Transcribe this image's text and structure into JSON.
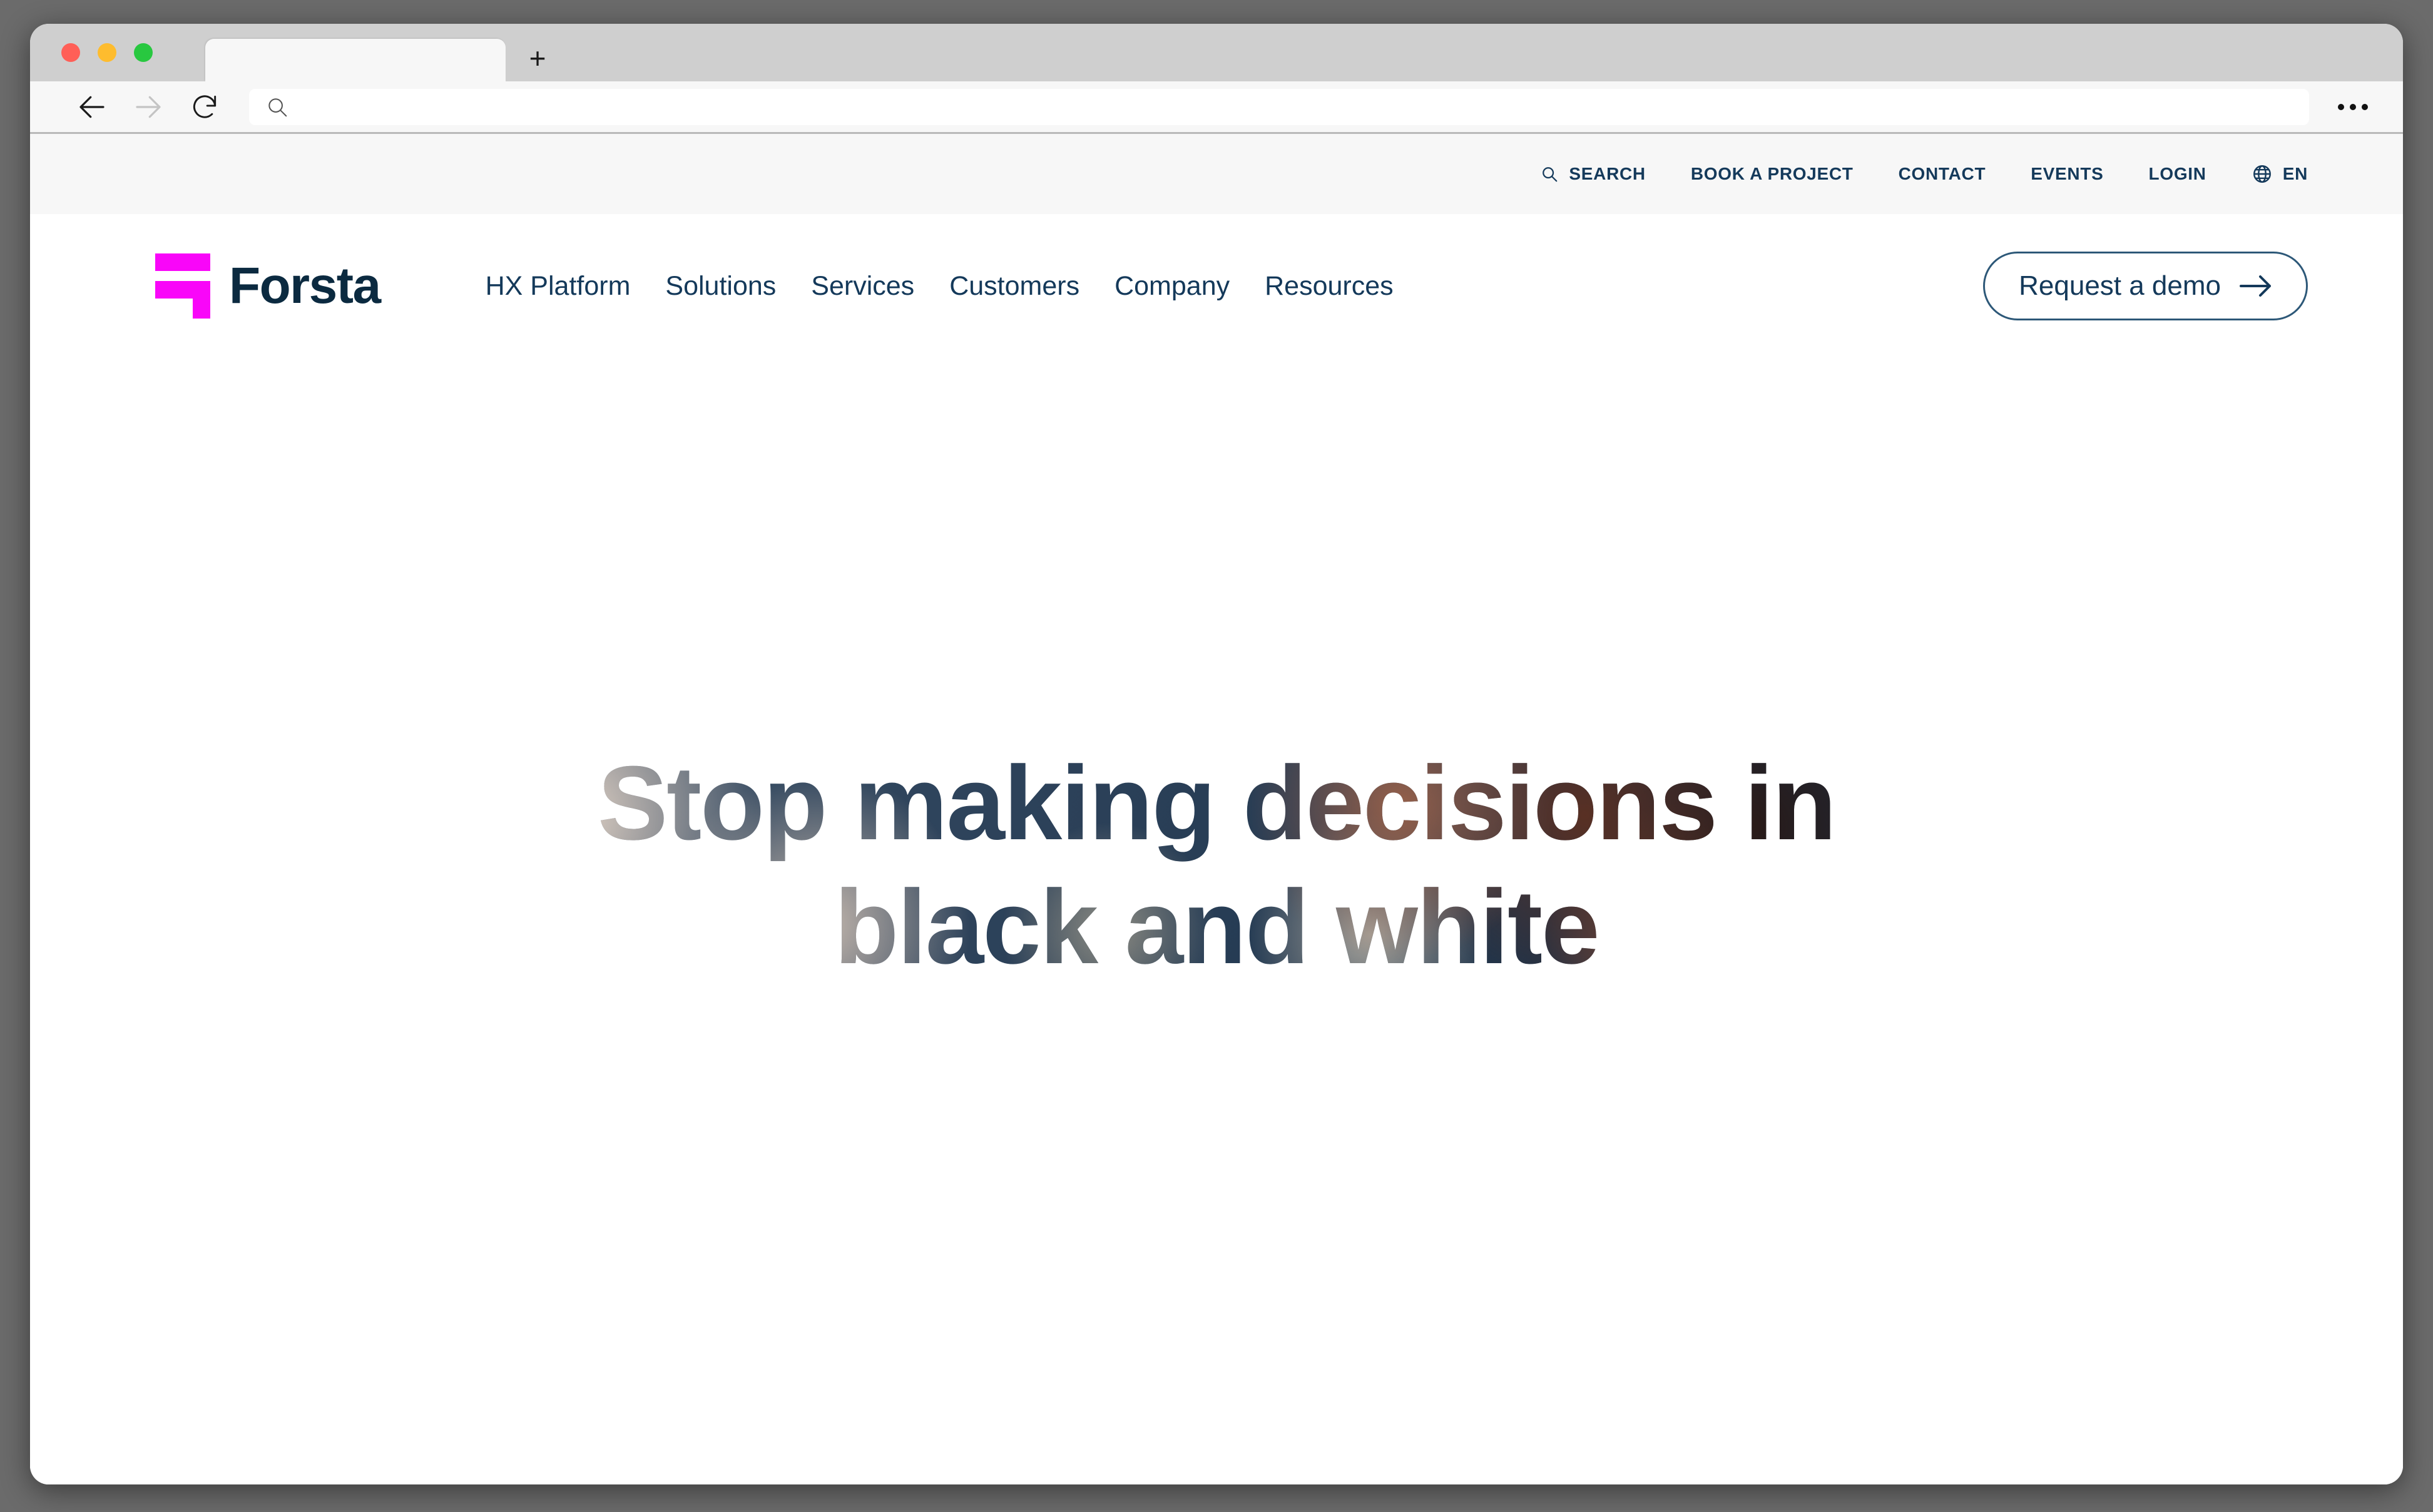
{
  "browser": {
    "traffic_lights": [
      "close",
      "minimize",
      "maximize"
    ],
    "tab_title": "",
    "new_tab_label": "+",
    "url_value": "",
    "url_placeholder": "",
    "back_icon": "back-arrow-icon",
    "forward_icon": "forward-arrow-icon",
    "reload_icon": "reload-icon",
    "search_icon": "search-icon",
    "overflow_label": "..."
  },
  "site": {
    "utility_bar": {
      "items": [
        {
          "label": "SEARCH",
          "icon": "search-icon"
        },
        {
          "label": "BOOK A PROJECT",
          "icon": ""
        },
        {
          "label": "CONTACT",
          "icon": ""
        },
        {
          "label": "EVENTS",
          "icon": ""
        },
        {
          "label": "LOGIN",
          "icon": ""
        },
        {
          "label": "EN",
          "icon": "globe-icon"
        }
      ]
    },
    "logo": {
      "wordmark": "Forsta",
      "mark_color": "#f906f9",
      "word_color": "#0b2a40"
    },
    "nav": {
      "items": [
        {
          "label": "HX Platform"
        },
        {
          "label": "Solutions"
        },
        {
          "label": "Services"
        },
        {
          "label": "Customers"
        },
        {
          "label": "Company"
        },
        {
          "label": "Resources"
        }
      ]
    },
    "cta": {
      "label": "Request a demo",
      "icon": "arrow-right-icon"
    },
    "hero": {
      "headline_line1": "Stop making decisions in",
      "headline_line2": "black and white"
    },
    "colors": {
      "brand_magenta": "#f906f9",
      "brand_navy": "#0b2a40",
      "nav_text": "#14395a",
      "utility_bg": "#f7f7f7",
      "page_bg": "#ffffff"
    }
  }
}
